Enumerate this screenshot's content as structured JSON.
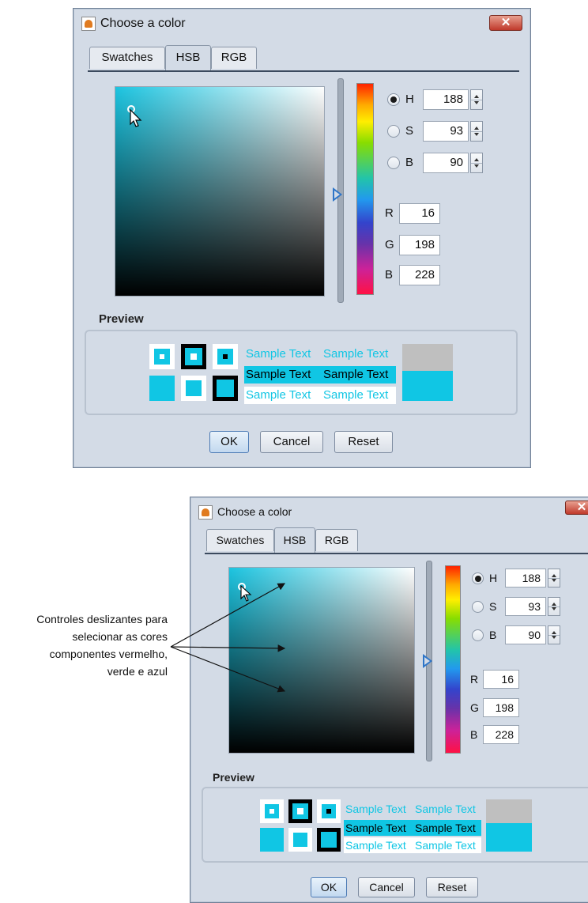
{
  "dialog_title": "Choose a color",
  "close_glyph": "✕",
  "tabs": [
    "Swatches",
    "HSB",
    "RGB"
  ],
  "active_tab": "HSB",
  "hsb": {
    "h": {
      "label": "H",
      "value": "188",
      "selected": true
    },
    "s": {
      "label": "S",
      "value": "93",
      "selected": false
    },
    "b": {
      "label": "B",
      "value": "90",
      "selected": false
    }
  },
  "rgb": {
    "r": {
      "label": "R",
      "value": "16"
    },
    "g": {
      "label": "G",
      "value": "198"
    },
    "b": {
      "label": "B",
      "value": "228"
    }
  },
  "preview": {
    "label": "Preview",
    "sample_text": "Sample Text"
  },
  "buttons": {
    "ok": "OK",
    "cancel": "Cancel",
    "reset": "Reset"
  },
  "annotation": [
    "Controles deslizantes para",
    "selecionar as cores",
    "componentes vermelho,",
    "verde e azul"
  ],
  "colors": {
    "selected": "#10c6e4",
    "previous": "#bfbfbf",
    "panel": "#d3dbe6"
  }
}
